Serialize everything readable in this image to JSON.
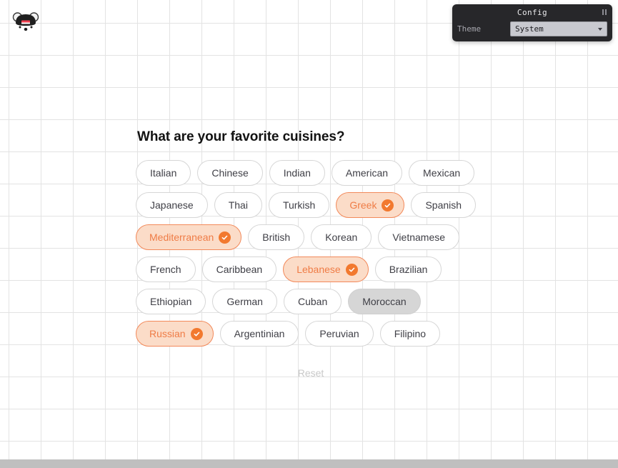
{
  "logo": {
    "icon": "panda-face-logo"
  },
  "config_panel": {
    "title": "Config",
    "collapse_icon": "collapse-pause-icon",
    "theme_label": "Theme",
    "theme_value": "System",
    "theme_options": [
      "System"
    ],
    "caret_icon": "chevron-down-icon"
  },
  "form": {
    "title": "What are your favorite cuisines?",
    "reset_label": "Reset",
    "check_icon": "check-circle-icon",
    "chips": [
      {
        "label": "Italian",
        "state": "default"
      },
      {
        "label": "Chinese",
        "state": "default"
      },
      {
        "label": "Indian",
        "state": "default"
      },
      {
        "label": "American",
        "state": "default"
      },
      {
        "label": "Mexican",
        "state": "default"
      },
      {
        "label": "Japanese",
        "state": "default"
      },
      {
        "label": "Thai",
        "state": "default"
      },
      {
        "label": "Turkish",
        "state": "default"
      },
      {
        "label": "Greek",
        "state": "selected"
      },
      {
        "label": "Spanish",
        "state": "default"
      },
      {
        "label": "Mediterranean",
        "state": "selected"
      },
      {
        "label": "British",
        "state": "default"
      },
      {
        "label": "Korean",
        "state": "default"
      },
      {
        "label": "Vietnamese",
        "state": "default"
      },
      {
        "label": "French",
        "state": "default"
      },
      {
        "label": "Caribbean",
        "state": "default"
      },
      {
        "label": "Lebanese",
        "state": "selected"
      },
      {
        "label": "Brazilian",
        "state": "default"
      },
      {
        "label": "Ethiopian",
        "state": "default"
      },
      {
        "label": "German",
        "state": "default"
      },
      {
        "label": "Cuban",
        "state": "default"
      },
      {
        "label": "Moroccan",
        "state": "hovered"
      },
      {
        "label": "Russian",
        "state": "selected"
      },
      {
        "label": "Argentinian",
        "state": "default"
      },
      {
        "label": "Peruvian",
        "state": "default"
      },
      {
        "label": "Filipino",
        "state": "default"
      }
    ]
  },
  "colors": {
    "accent": "#f2792f",
    "selected_bg": "#fbdcc8",
    "selected_border": "#f2895a",
    "selected_text": "#ef7c46",
    "chip_border": "#d6d6d6",
    "hover_bg": "#d6d6d6",
    "panel_bg": "#27272a",
    "grid_line": "#e3e3e3",
    "scrollbar": "#bfbfbf"
  }
}
